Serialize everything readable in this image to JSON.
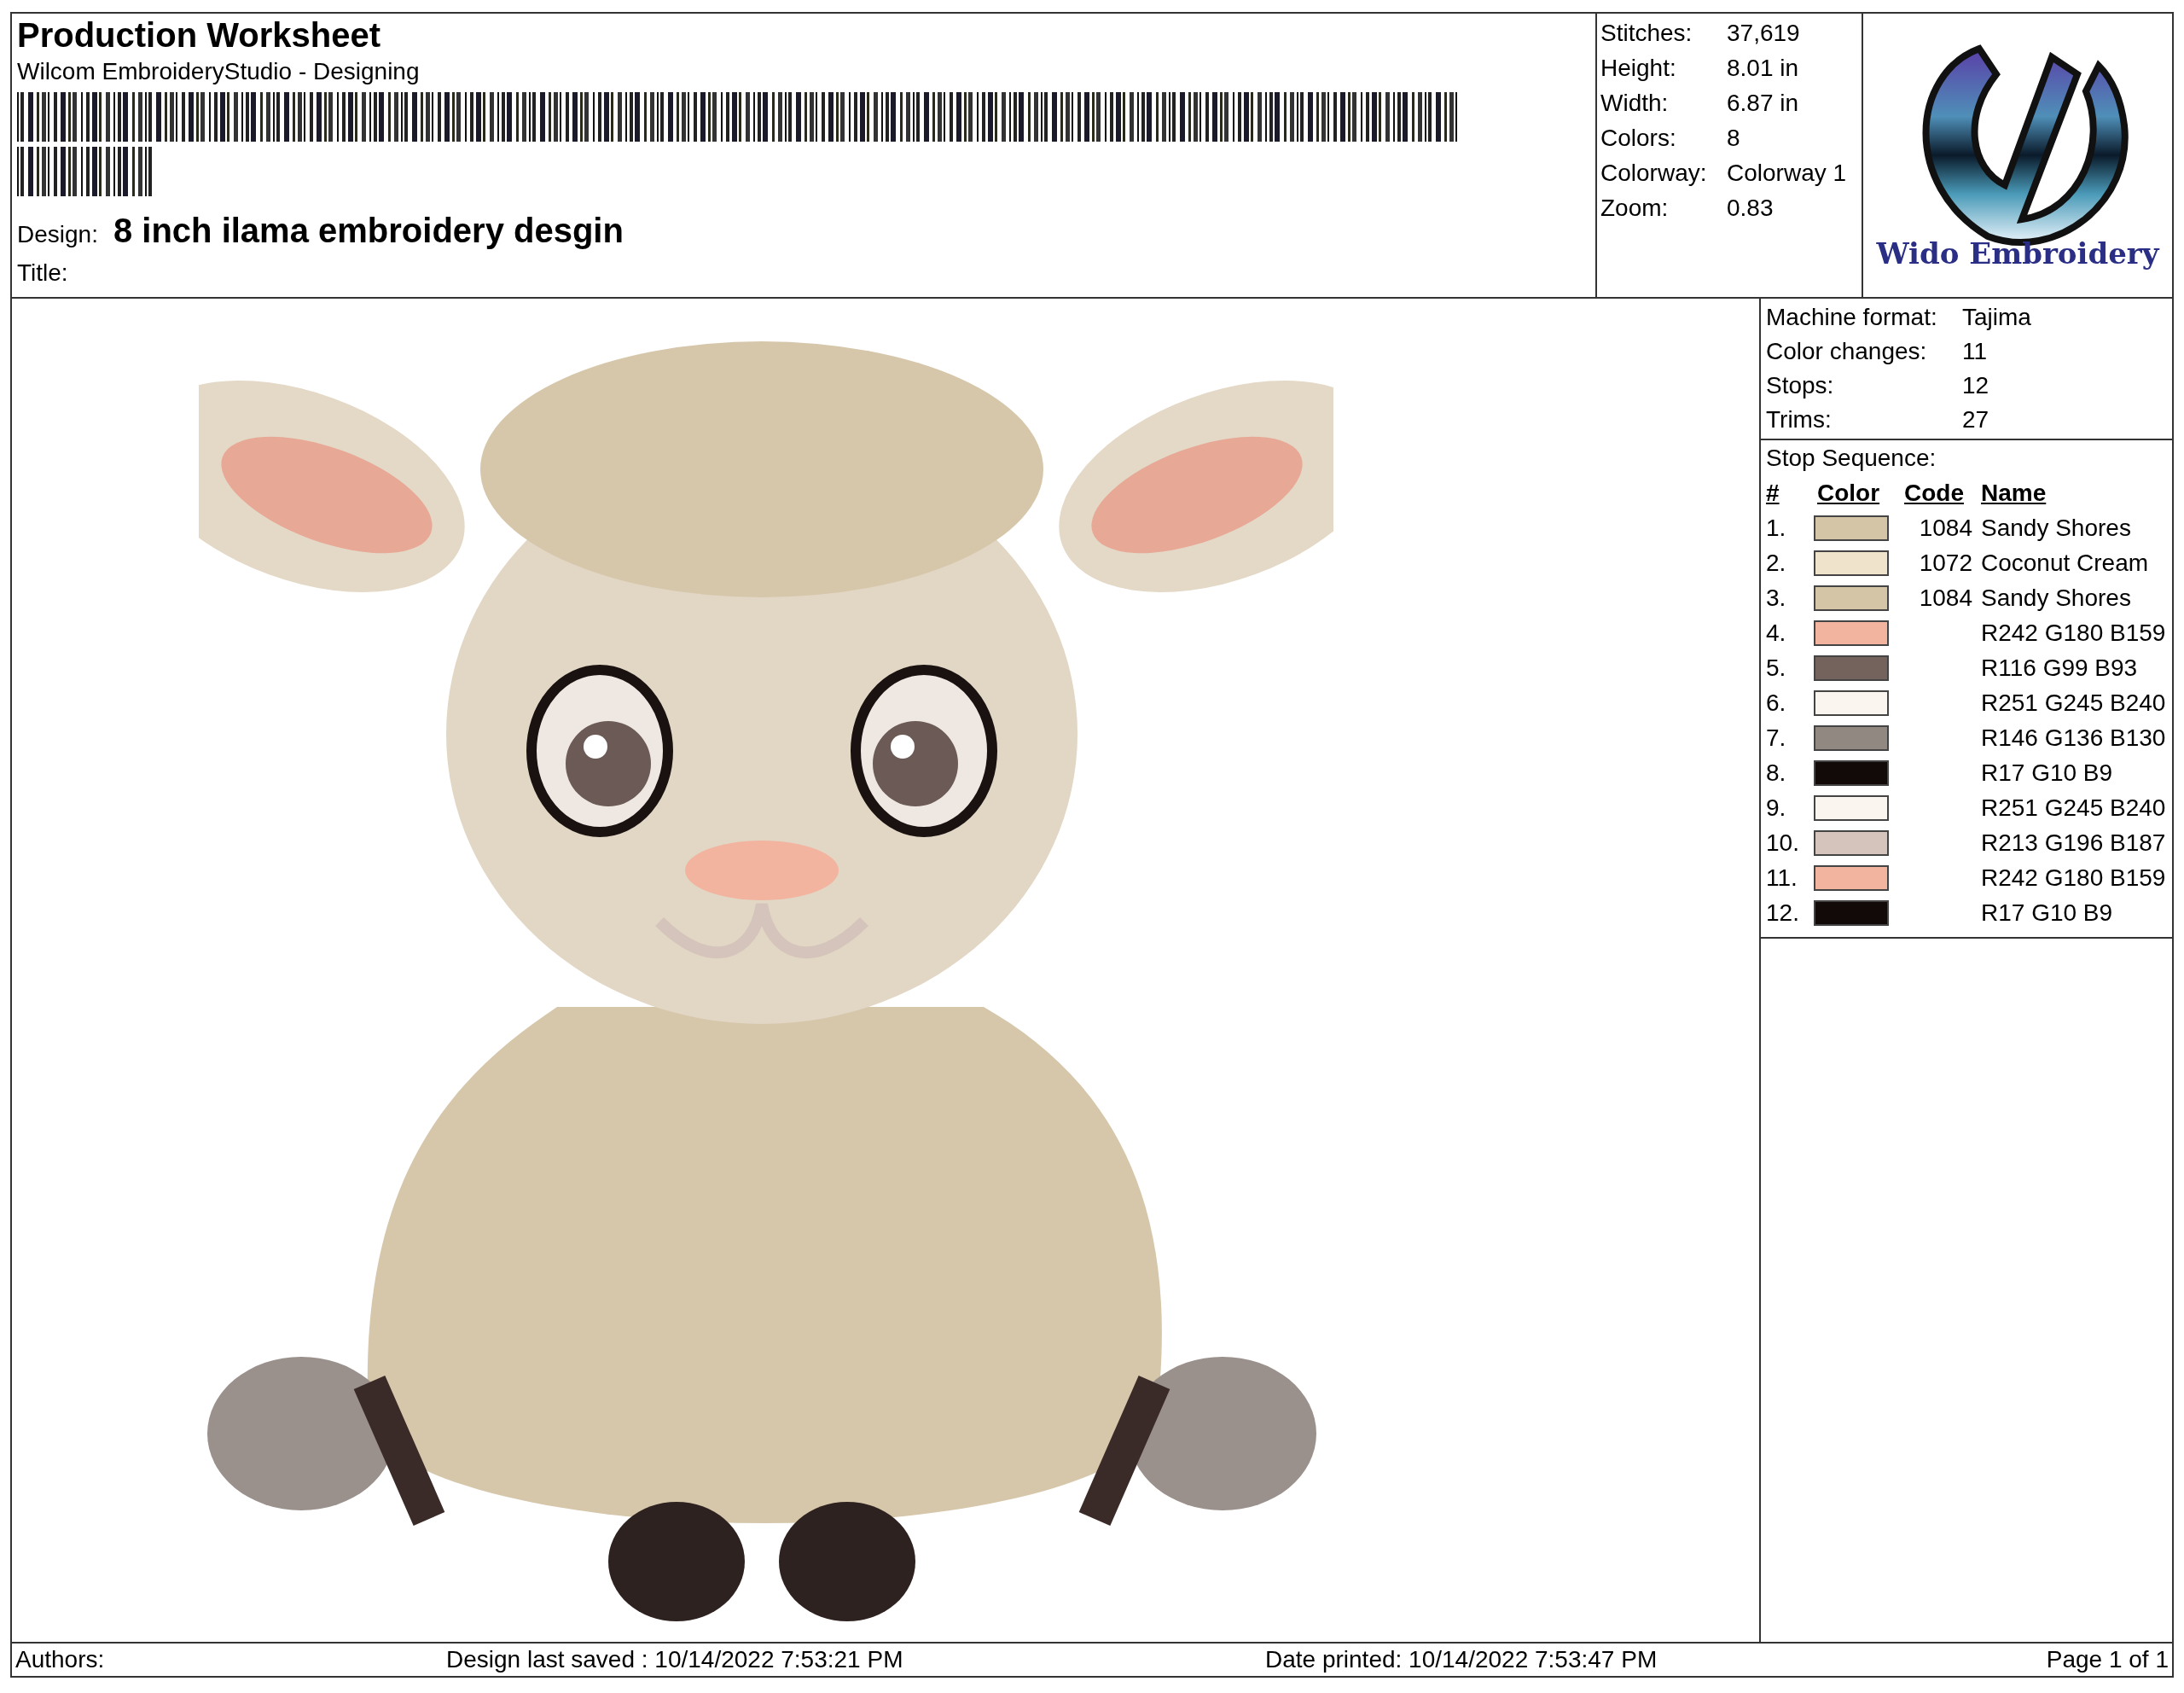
{
  "header": {
    "title": "Production Worksheet",
    "app": "Wilcom EmbroideryStudio - Designing",
    "design_label": "Design:",
    "design": "8 inch ilama embroidery desgin",
    "title_label": "Title:"
  },
  "stats": [
    {
      "label": "Stitches:",
      "value": "37,619"
    },
    {
      "label": "Height:",
      "value": "8.01 in"
    },
    {
      "label": "Width:",
      "value": "6.87 in"
    },
    {
      "label": "Colors:",
      "value": "8"
    },
    {
      "label": "Colorway:",
      "value": "Colorway 1"
    },
    {
      "label": "Zoom:",
      "value": "0.83"
    }
  ],
  "logo": {
    "text": "Wido Embroidery"
  },
  "machine": [
    {
      "label": "Machine format:",
      "value": "Tajima"
    },
    {
      "label": "Color changes:",
      "value": "11"
    },
    {
      "label": "Stops:",
      "value": "12"
    },
    {
      "label": "Trims:",
      "value": "27"
    }
  ],
  "stop_sequence": {
    "title": "Stop Sequence:",
    "columns": [
      "#",
      "Color",
      "Code",
      "Name"
    ],
    "rows": [
      {
        "number": "1.",
        "color": "#d4c5a6",
        "code": "1084",
        "name": "Sandy Shores"
      },
      {
        "number": "2.",
        "color": "#f0e3cc",
        "code": "1072",
        "name": "Coconut Cream"
      },
      {
        "number": "3.",
        "color": "#d4c5a6",
        "code": "1084",
        "name": "Sandy Shores"
      },
      {
        "number": "4.",
        "color": "#f2b49f",
        "name": "R242 G180 B159"
      },
      {
        "number": "5.",
        "color": "#74635d",
        "name": "R116 G99 B93"
      },
      {
        "number": "6.",
        "color": "#fbf5f0",
        "name": "R251 G245 B240"
      },
      {
        "number": "7.",
        "color": "#928882",
        "name": "R146 G136 B130"
      },
      {
        "number": "8.",
        "color": "#110a09",
        "name": "R17 G10 B9"
      },
      {
        "number": "9.",
        "color": "#fbf5f0",
        "name": "R251 G245 B240"
      },
      {
        "number": "10.",
        "color": "#d5c4bb",
        "name": "R213 G196 B187"
      },
      {
        "number": "11.",
        "color": "#f2b49f",
        "name": "R242 G180 B159"
      },
      {
        "number": "12.",
        "color": "#110a09",
        "name": "R17 G10 B9"
      }
    ]
  },
  "footer": {
    "authors": "Authors:",
    "saved": "Design last saved : 10/14/2022 7:53:21 PM",
    "printed": "Date printed: 10/14/2022 7:53:47 PM",
    "page": "Page 1 of 1"
  }
}
